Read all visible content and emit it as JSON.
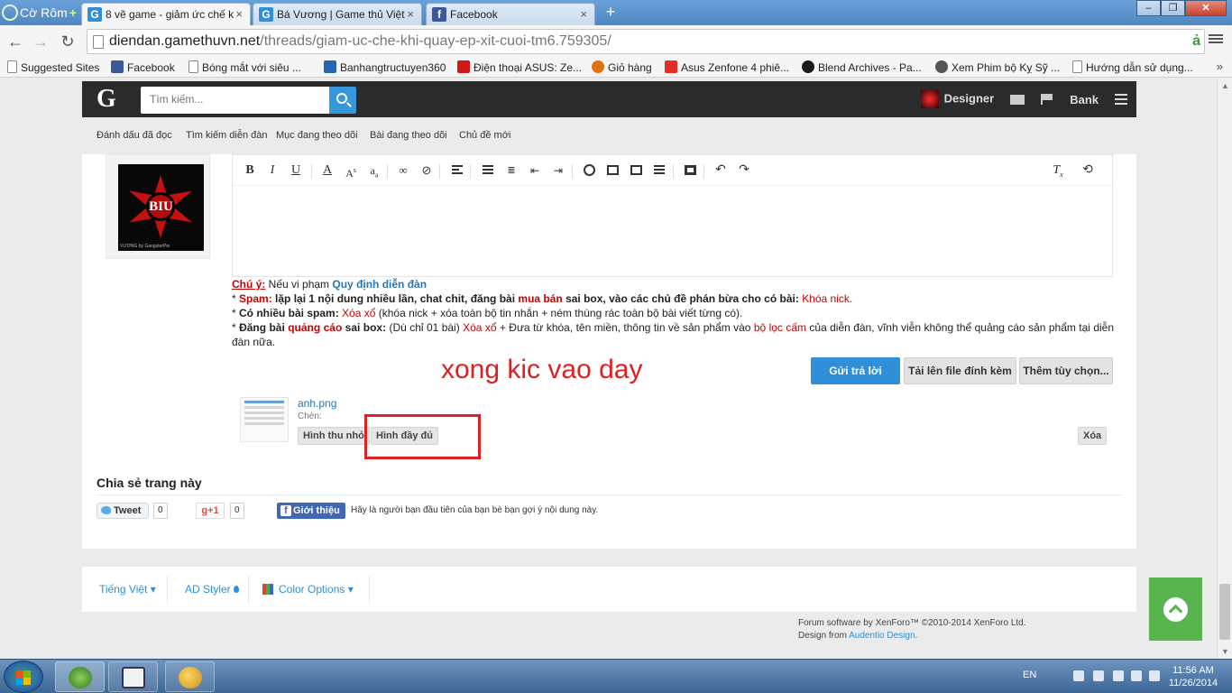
{
  "browser": {
    "brand": "Cờ Rôm",
    "brand_plus": "+",
    "tabs": [
      {
        "title": "8 vẽ game - giảm ức chế k",
        "favicon": "G",
        "active": true
      },
      {
        "title": "Bá Vương | Game thủ Việt",
        "favicon": "G",
        "active": false
      },
      {
        "title": "Facebook",
        "favicon": "f",
        "active": false
      }
    ],
    "url_host": "diendan.gamethuvn.net",
    "url_path": "/threads/giam-uc-che-khi-quay-ep-xit-cuoi-tm6.759305/",
    "extension_icon": "ả",
    "bookmarks": [
      {
        "label": "Suggested Sites",
        "icon": "page-icon"
      },
      {
        "label": "Facebook",
        "icon": "facebook-icon"
      },
      {
        "label": "Bóng mắt với siêu ...",
        "icon": "page-icon"
      },
      {
        "label": "Banhangtructuyen360",
        "icon": "store-icon"
      },
      {
        "label": "Điện thoại ASUS: Ze...",
        "icon": "asus-icon"
      },
      {
        "label": "Giỏ hàng",
        "icon": "cart-icon"
      },
      {
        "label": "Asus Zenfone 4 phiê...",
        "icon": "youtube-icon"
      },
      {
        "label": "Blend Archives - Pa...",
        "icon": "blend-icon"
      },
      {
        "label": "Xem Phim bộ Kỵ Sỹ ...",
        "icon": "film-icon"
      },
      {
        "label": "Hướng dẫn sử dụng...",
        "icon": "page-icon"
      }
    ],
    "bookmarks_more": "»"
  },
  "site": {
    "logo": "G",
    "search_placeholder": "Tìm kiếm...",
    "user_name": "Designer",
    "bank_label": "Bank",
    "subnav": [
      "Đánh dấu đã đọc",
      "Tìm kiếm diễn đàn",
      "Mục đang theo dõi",
      "Bài đang theo dõi",
      "Chủ đề mới"
    ]
  },
  "avatar": {
    "text": "BIU",
    "caption": "VƯƠNG by GangsterPie"
  },
  "rules": {
    "intro_label": "Chú ý:",
    "intro_text": " Nếu vi phạm ",
    "intro_link": "Quy định diễn đàn",
    "spam_label": "Spam:",
    "spam_text": " lặp lại 1 nội dung nhiều lần, chat chit, đăng bài ",
    "spam_red": "mua bán",
    "spam_text2": " sai box, vào các chủ đề phán bừa cho có bài: ",
    "spam_penalty": "Khóa nick.",
    "many_label": "Có nhiều bài spam:",
    "many_red": "Xóa xổ",
    "many_text": " (khóa nick + xóa toàn bộ tin nhắn + ném thùng rác toàn bộ bài viết từng có).",
    "ads_label1": "Đăng bài ",
    "ads_red": "quảng cáo",
    "ads_label2": " sai box:",
    "ads_text1": " (Dù chỉ 01 bài) ",
    "ads_red2": "Xóa xổ",
    "ads_text2": " + Đưa từ khóa, tên miền, thông tin về sản phẩm vào ",
    "ads_red3": "bộ lọc cấm",
    "ads_text3": " của diễn đàn, vĩnh viễn không thể quảng cáo sản phẩm tại diễn đàn nữa."
  },
  "annotation": "xong kic vao day",
  "buttons": {
    "reply": "Gửi trả lời",
    "upload": "Tải lên file đính kèm",
    "more_options": "Thêm tùy chọn..."
  },
  "attachment": {
    "name": "anh.png",
    "insert_label": "Chèn:",
    "thumb_btn": "Hình thu nhỏ",
    "full_btn": "Hình đầy đủ",
    "delete_btn": "Xóa"
  },
  "share": {
    "title": "Chia sẻ trang này",
    "tweet": "Tweet",
    "tweet_count": "0",
    "gplus": "g+1",
    "gplus_count": "0",
    "fb_like": "Giới thiệu",
    "fb_text": "Hãy là người bạn đầu tiên của bạn bè bạn gợi ý nội dung này."
  },
  "footer": {
    "language": "Tiếng Việt",
    "styler": "AD Styler",
    "color_options": "Color Options",
    "copyright_line1": "Forum software by XenForo™ ©2010-2014 XenForo Ltd.",
    "design_prefix": "Design from ",
    "design_link": "Audentio Design",
    "design_suffix": "."
  },
  "taskbar": {
    "lang": "EN",
    "time": "11:56 AM",
    "date": "11/26/2014"
  }
}
